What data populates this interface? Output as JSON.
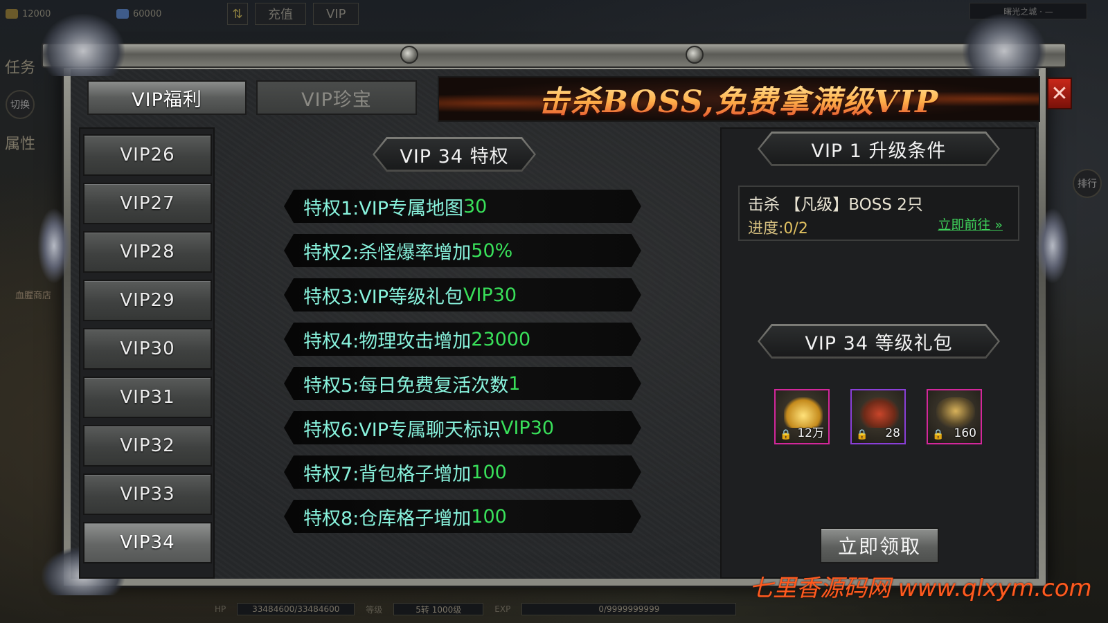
{
  "top_bar": {
    "gold": "12000",
    "diamonds": "60000",
    "swap_icon": "swap-icon",
    "recharge": "充值",
    "vip": "VIP",
    "region": "曙光之城 · —"
  },
  "left_side": {
    "quest": "任务",
    "switch": "切换",
    "attr": "属性",
    "shop": "血腥商店"
  },
  "right_side": {
    "rank": "排行"
  },
  "bottom_bar": {
    "hp_label": "HP",
    "hp_value": "33484600/33484600",
    "level_label": "等级",
    "level_value": "5转  1000级",
    "exp_label": "EXP",
    "exp_value": "0/9999999999"
  },
  "panel": {
    "tabs": [
      {
        "label": "VIP福利",
        "active": true
      },
      {
        "label": "VIP珍宝",
        "active": false
      }
    ],
    "banner": "击杀BOSS,免费拿满级VIP",
    "close_icon": "close-icon",
    "vip_levels": [
      {
        "label": "VIP26"
      },
      {
        "label": "VIP27"
      },
      {
        "label": "VIP28"
      },
      {
        "label": "VIP29"
      },
      {
        "label": "VIP30"
      },
      {
        "label": "VIP31"
      },
      {
        "label": "VIP32"
      },
      {
        "label": "VIP33"
      },
      {
        "label": "VIP34",
        "selected": true
      }
    ],
    "privilege_title": "VIP 34 特权",
    "privileges": [
      {
        "name": "特权1:VIP专属地图",
        "value": "30"
      },
      {
        "name": "特权2:杀怪爆率增加",
        "value": "50%"
      },
      {
        "name": "特权3:VIP等级礼包",
        "value": "VIP30"
      },
      {
        "name": "特权4:物理攻击增加",
        "value": "23000"
      },
      {
        "name": "特权5:每日免费复活次数",
        "value": "1"
      },
      {
        "name": "特权6:VIP专属聊天标识",
        "value": "VIP30"
      },
      {
        "name": "特权7:背包格子增加",
        "value": "100"
      },
      {
        "name": "特权8:仓库格子增加",
        "value": "100"
      }
    ],
    "upgrade": {
      "title": "VIP  1  升级条件",
      "condition": "击杀 【凡级】BOSS 2只",
      "progress_label": "进度:",
      "progress_value": "0/2",
      "goto_link": "立即前往 »"
    },
    "gift": {
      "title": "VIP 34 等级礼包",
      "items": [
        {
          "icon": "gold-ingot-icon",
          "count": "12万",
          "frame": "#d3279b"
        },
        {
          "icon": "bag-icon",
          "count": "28",
          "frame": "#8a3fd8"
        },
        {
          "icon": "armor-icon",
          "count": "160",
          "frame": "#d3279b"
        }
      ],
      "claim_button": "立即领取"
    }
  },
  "watermark": "七里香源码网 www.qlxym.com"
}
